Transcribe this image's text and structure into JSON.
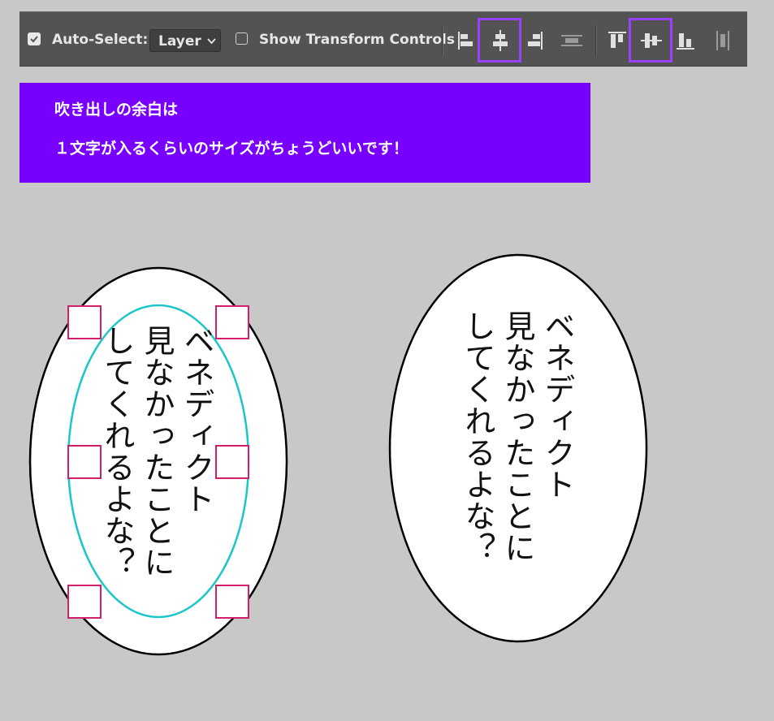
{
  "toolbar": {
    "auto_select_label": "Auto-Select:",
    "auto_select_checked": true,
    "layer_select_value": "Layer",
    "show_transform_label": "Show Transform Controls",
    "show_transform_checked": false,
    "highlight_color": "#9a40ff",
    "icons": [
      "align-left-edges-icon",
      "align-horizontal-centers-icon",
      "align-right-edges-icon",
      "distribute-vertical-icon",
      "align-top-edges-icon",
      "align-vertical-centers-icon",
      "align-bottom-edges-icon",
      "distribute-horizontal-icon"
    ],
    "highlighted_icons": [
      "align-horizontal-centers-icon",
      "align-vertical-centers-icon"
    ]
  },
  "banner": {
    "background": "#7700ff",
    "line1": "吹き出しの余白は",
    "line2": "１文字が入るくらいのサイズがちょうどいいです！"
  },
  "bubbles": {
    "text_lines": [
      "ベネディクト",
      "見なかったことに",
      "してくれるよな？"
    ],
    "guide_color": "#1cc6c6",
    "handle_color": "#d0206a"
  }
}
